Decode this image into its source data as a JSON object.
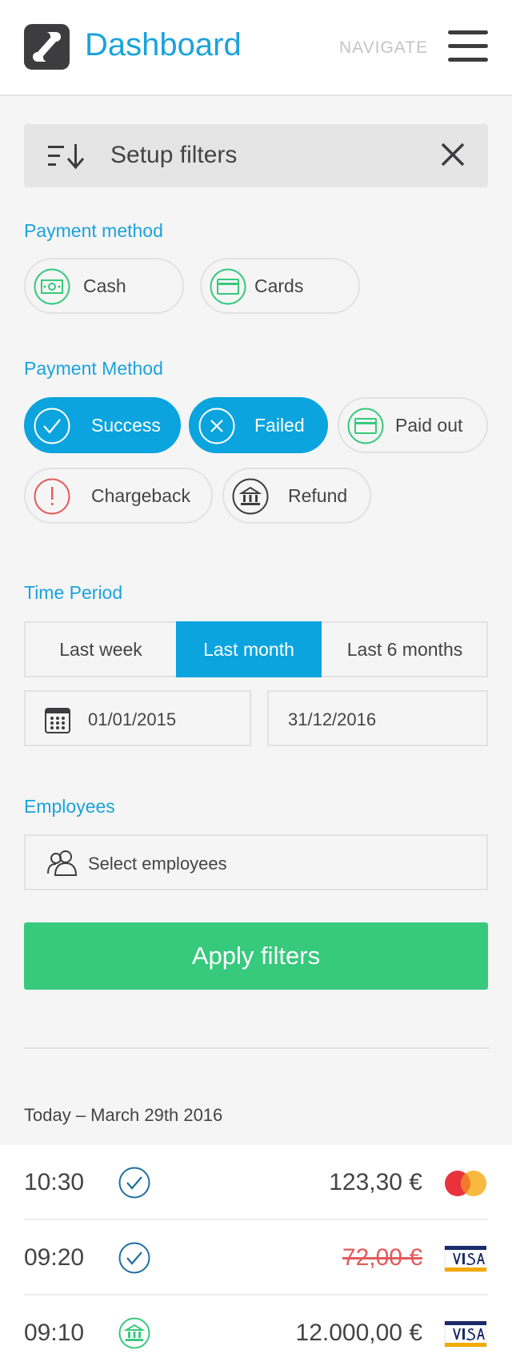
{
  "header": {
    "title": "Dashboard",
    "nav_label": "NAVIGATE"
  },
  "filter_bar": {
    "title": "Setup filters"
  },
  "payment_method": {
    "label": "Payment method",
    "options": [
      {
        "label": "Cash",
        "icon": "cash-icon",
        "active": false
      },
      {
        "label": "Cards",
        "icon": "card-icon",
        "active": false
      }
    ]
  },
  "payment_status": {
    "label": "Payment Method",
    "options": [
      {
        "label": "Success",
        "icon": "check-circle-icon",
        "active": true
      },
      {
        "label": "Failed",
        "icon": "x-circle-icon",
        "active": true
      },
      {
        "label": "Paid out",
        "icon": "card-icon",
        "active": false
      },
      {
        "label": "Chargeback",
        "icon": "alert-icon",
        "active": false
      },
      {
        "label": "Refund",
        "icon": "refund-icon",
        "active": false
      }
    ]
  },
  "time_period": {
    "label": "Time Period",
    "options": [
      {
        "label": "Last week",
        "active": false
      },
      {
        "label": "Last month",
        "active": true
      },
      {
        "label": "Last 6 months",
        "active": false
      }
    ],
    "from_date": "01/01/2015",
    "to_date": "31/12/2016"
  },
  "employees": {
    "label": "Employees",
    "placeholder": "Select employees"
  },
  "apply_button": "Apply filters",
  "transactions": {
    "date_header": "Today – March 29th 2016",
    "items": [
      {
        "time": "10:30",
        "status": "success",
        "amount": "123,30 €",
        "voided": false,
        "brand": "MasterCard"
      },
      {
        "time": "09:20",
        "status": "success",
        "amount": "72,00 €",
        "voided": true,
        "brand": "VISA"
      },
      {
        "time": "09:10",
        "status": "paid-out",
        "amount": "12.000,00 €",
        "voided": false,
        "brand": "VISA"
      }
    ]
  },
  "colors": {
    "accent": "#1aa3dc",
    "active_chip": "#0ba4de",
    "apply": "#37c97c",
    "green_icon": "#37c97c",
    "red_icon": "#e25b5b",
    "void_amount": "#e25b5b"
  }
}
